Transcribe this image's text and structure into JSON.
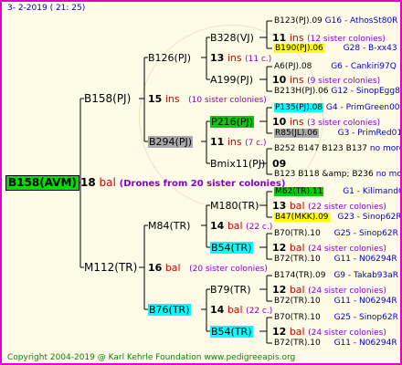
{
  "header": "3-  2-2019 ( 21: 25)",
  "footer": "Copyright 2004-2019 @ Karl Kehrle Foundation    www.pedigreeapis.org",
  "root": {
    "label": "B158(AVM)",
    "inbreeding": "18",
    "kind": "bal",
    "note": "(Drones from 20 sister colonies)"
  },
  "gen1": [
    {
      "label": "B158(PJ)",
      "inbreeding": "15",
      "kind": "ins",
      "note": "(10 sister colonies)"
    },
    {
      "label": "M112(TR)",
      "inbreeding": "16",
      "kind": "bal",
      "note": "(20 sister colonies)"
    }
  ],
  "gen2": [
    {
      "label": "B126(PJ)",
      "inbreeding": "13",
      "kind": "ins",
      "note": "(11 c.)"
    },
    {
      "label": "B294(PJ)",
      "inbreeding": "11",
      "kind": "ins",
      "note": "(7 c.)"
    },
    {
      "label": "M84(TR)",
      "inbreeding": "14",
      "kind": "bal",
      "note": "(22 c.)"
    },
    {
      "label": "B76(TR)",
      "inbreeding": "14",
      "kind": "bal",
      "note": "(22 c.)"
    }
  ],
  "gen3": [
    {
      "label": "B328(VJ)",
      "inbreeding": "11",
      "kind": "ins",
      "note": "(12 sister colonies)"
    },
    {
      "label": "A199(PJ)",
      "inbreeding": "10",
      "kind": "ins",
      "note": "(9 sister colonies)"
    },
    {
      "label": "P216(PJ)",
      "inbreeding": "10",
      "kind": "ins",
      "note": "(3 sister colonies)"
    },
    {
      "label": "Bmix11(PJ)",
      "inbreeding": "09",
      "kind": "",
      "note": ""
    },
    {
      "label": "M180(TR)",
      "inbreeding": "13",
      "kind": "bal",
      "note": "(22 sister colonies)"
    },
    {
      "label": "B54(TR)",
      "inbreeding": "12",
      "kind": "bal",
      "note": "(24 sister colonies)"
    },
    {
      "label": "B79(TR)",
      "inbreeding": "12",
      "kind": "bal",
      "note": "(24 sister colonies)"
    },
    {
      "label": "B54(TR)",
      "inbreeding": "12",
      "kind": "bal",
      "note": "(24 sister colonies)"
    }
  ],
  "gen4": [
    {
      "queen": "B123(PJ).09",
      "gen": "G16 - AthosSt80R"
    },
    {
      "queen": "B190(PJ).06",
      "gen": "G28 - B-xx43"
    },
    {
      "queen": "A6(PJ).08",
      "gen": "G6 - Cankiri97Q"
    },
    {
      "queen": "B213H(PJ).06",
      "gen": "G12 - SinopEgg86R"
    },
    {
      "queen": "P135(PJ).08",
      "gen": "G4 - PrimGreen00"
    },
    {
      "queen": "R85(JL).06",
      "gen": "G3 - PrimRed01"
    },
    {
      "queen": "B252 B147 B123 B137",
      "gen": "no more"
    },
    {
      "queen": "B123 B118 &amp; B236",
      "gen": "no more"
    },
    {
      "queen": "M62(TR).11",
      "gen": "G1 - KilimandQ"
    },
    {
      "queen": "B47(MKK).09",
      "gen": "G23 - Sinop62R"
    },
    {
      "queen": "B70(TR).10",
      "gen": "G25 - Sinop62R"
    },
    {
      "queen": "B72(TR).10",
      "gen": "G11 - N06294R"
    },
    {
      "queen": "B174(TR).09",
      "gen": "G9 - Takab93aR"
    },
    {
      "queen": "B72(TR).10",
      "gen": "G11 - N06294R"
    },
    {
      "queen": "B70(TR).10",
      "gen": "G25 - Sinop62R"
    },
    {
      "queen": "B72(TR).10",
      "gen": "G11 - N06294R"
    }
  ]
}
